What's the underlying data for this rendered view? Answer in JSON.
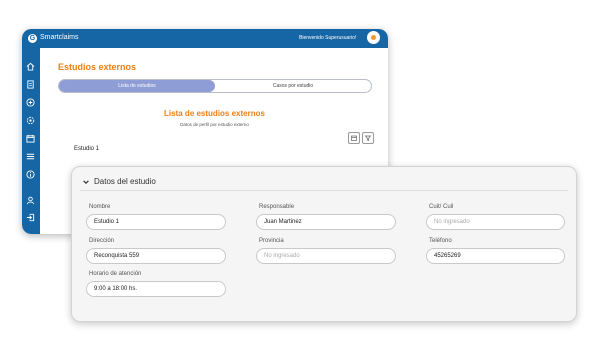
{
  "app": {
    "brand": "Smartclaims",
    "welcome": "Bienvenido Superusuario!"
  },
  "sidebar": {
    "icons": [
      "home-icon",
      "document-icon",
      "add-circle-icon",
      "settings-icon",
      "calendar-icon",
      "list-icon",
      "info-icon",
      "user-icon",
      "logout-icon"
    ]
  },
  "page": {
    "title": "Estudios externos",
    "tabs": [
      {
        "label": "Lista de estudios",
        "active": true
      },
      {
        "label": "Casos por estudio",
        "active": false
      }
    ],
    "list_title": "Lista de estudios externos",
    "list_subtitle": "Datos de perfil por estudio externo",
    "row_label": "Estudio 1"
  },
  "detail": {
    "title": "Datos del estudio",
    "fields": {
      "nombre": {
        "label": "Nombre",
        "value": "Estudio 1"
      },
      "responsable": {
        "label": "Responsable",
        "value": "Juan Martinez"
      },
      "cuit": {
        "label": "Cuit/ Cuil",
        "placeholder": "No ingresado"
      },
      "direccion": {
        "label": "Dirección",
        "value": "Reconquista 559"
      },
      "provincia": {
        "label": "Provincia",
        "placeholder": "No ingresado"
      },
      "telefono": {
        "label": "Teléfono",
        "value": "45265269"
      },
      "horario": {
        "label": "Horario de atención",
        "value": "9:00 a 18:00 hs."
      }
    }
  },
  "colors": {
    "primary": "#1666a6",
    "accent": "#f07f12",
    "tab_active": "#8f9dd6"
  }
}
